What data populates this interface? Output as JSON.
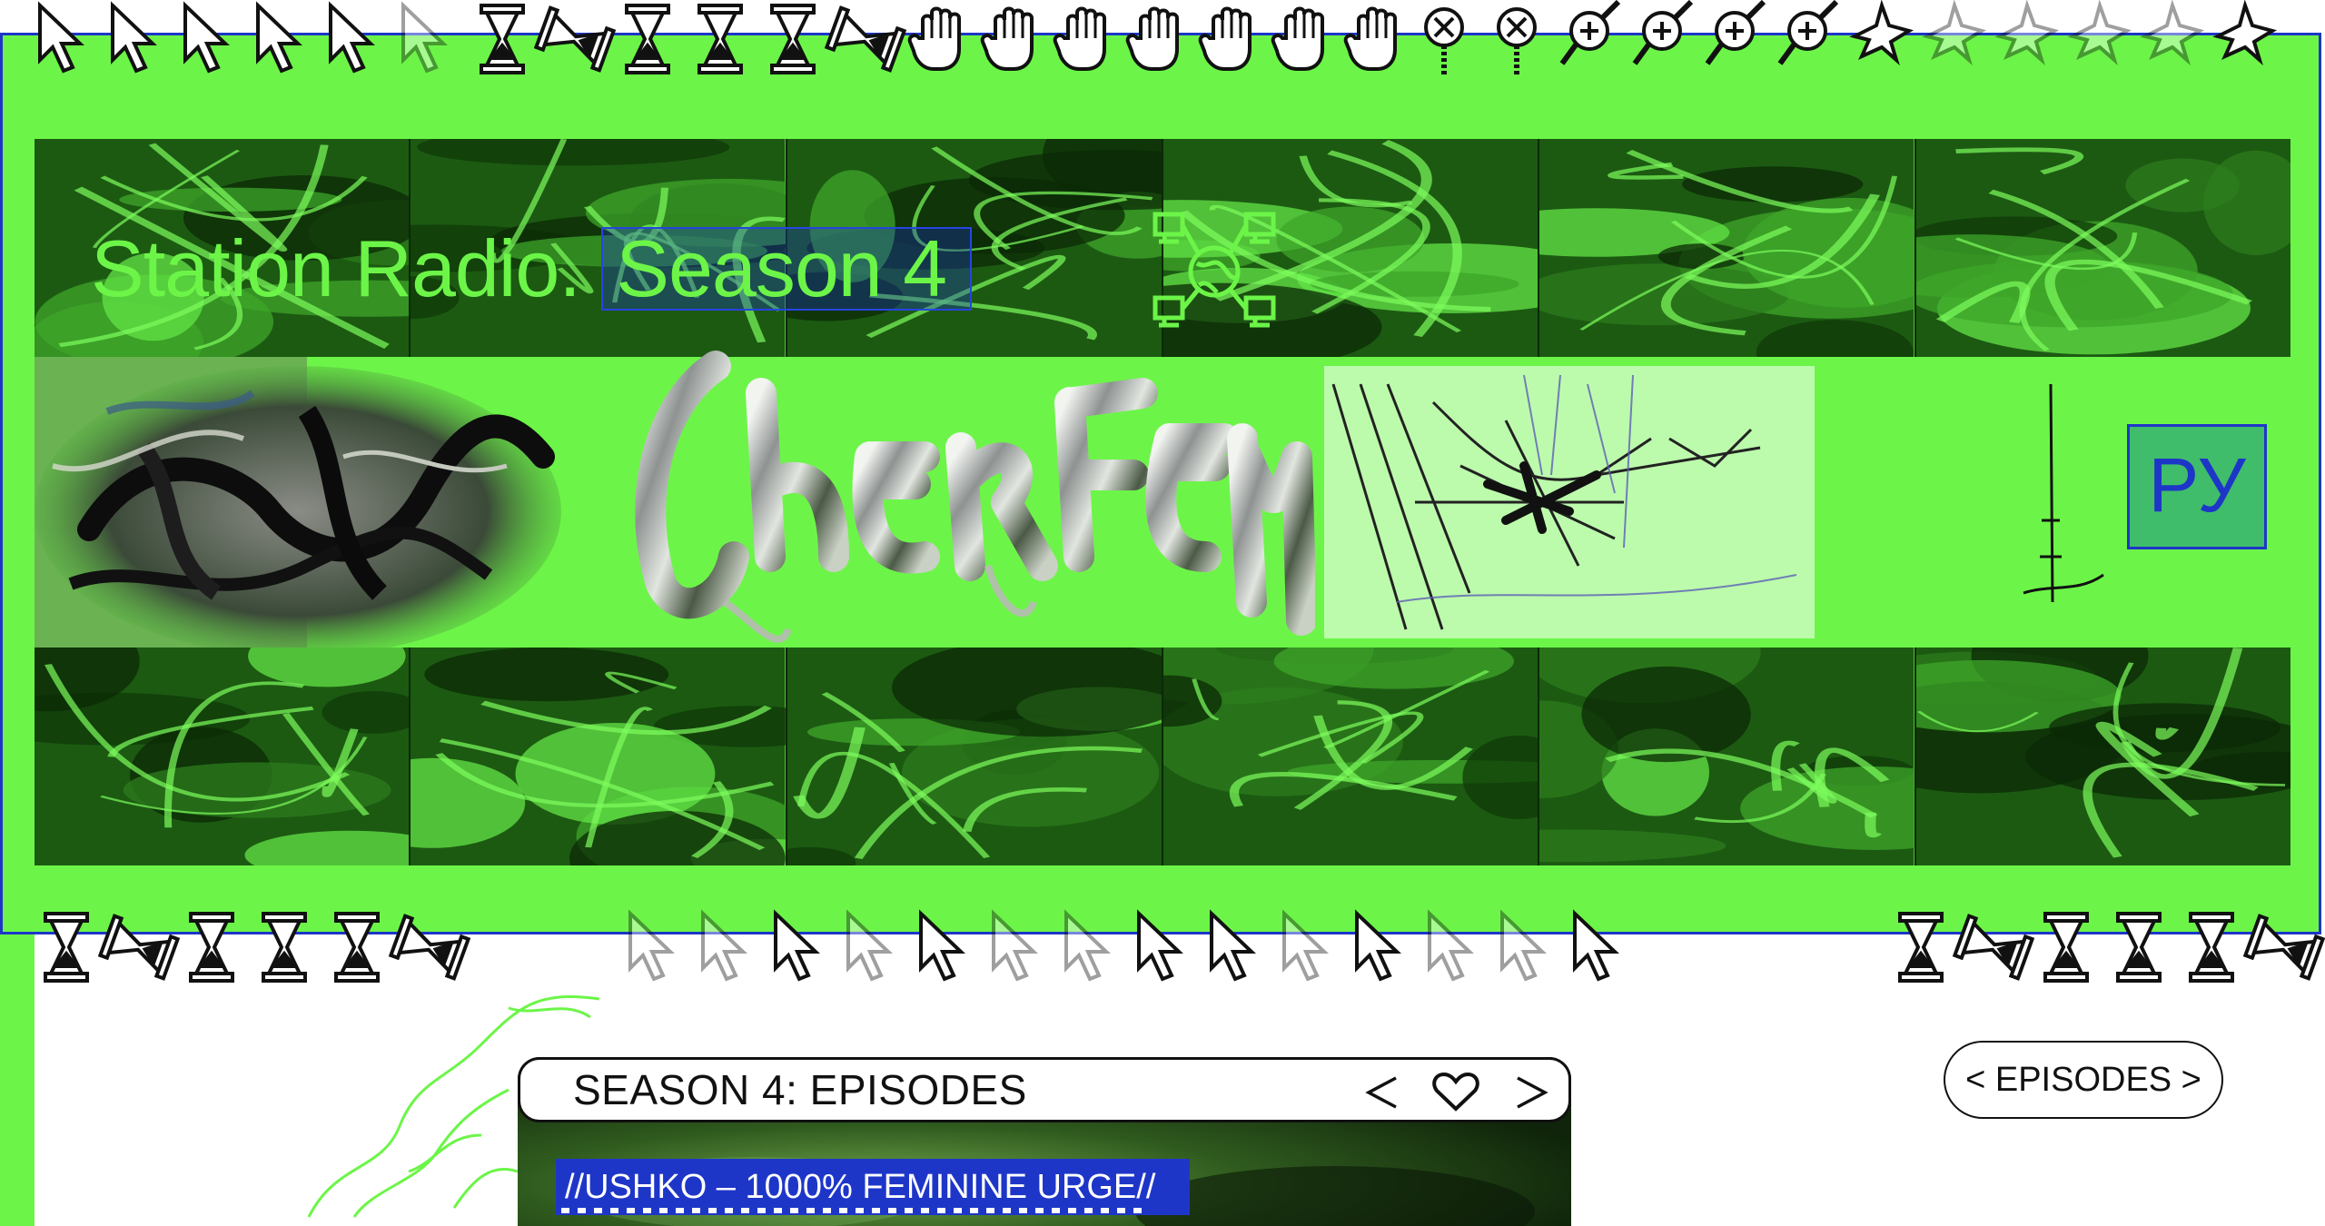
{
  "hero": {
    "title_plain": "Station Radio.",
    "title_highlight": "Season 4",
    "logo_text": "CHERTEM",
    "language_button": "РУ",
    "icon": "network-globe-icon"
  },
  "cursor_rows": {
    "top": [
      "arrow",
      "arrow",
      "arrow",
      "arrow",
      "arrow",
      "arrow-faded",
      "hourglass",
      "hourglass-tilt",
      "hourglass",
      "hourglass",
      "hourglass",
      "hourglass-tilt",
      "hand",
      "hand",
      "hand",
      "hand",
      "hand",
      "hand",
      "hand",
      "zoom-out",
      "zoom-out",
      "zoom-in",
      "zoom-in",
      "zoom-in",
      "zoom-in",
      "pointer-x",
      "pointer-x-faded",
      "pointer-x-faded",
      "pointer-x-faded",
      "pointer-x-faded",
      "pointer-x"
    ],
    "bottom_left": [
      "hourglass",
      "hourglass-tilt",
      "hourglass",
      "hourglass",
      "hourglass",
      "hourglass-tilt"
    ],
    "bottom_center": [
      "arrow-faded",
      "arrow-faded",
      "arrow",
      "arrow-faded",
      "arrow",
      "arrow-faded",
      "arrow-faded",
      "arrow",
      "arrow",
      "arrow-faded",
      "arrow",
      "arrow-faded",
      "arrow-faded",
      "arrow"
    ],
    "bottom_right": [
      "hourglass",
      "hourglass-tilt",
      "hourglass",
      "hourglass",
      "hourglass",
      "hourglass-tilt"
    ]
  },
  "episodes": {
    "panel_title": "SEASON 4: EPISODES",
    "prev_label": "<",
    "next_label": ">",
    "current_episode": "//USHKO – 1000% FEMININE URGE//",
    "nav_button": "< EPISODES >"
  },
  "colors": {
    "accent_green": "#6cf548",
    "accent_blue": "#1e36c8",
    "dark": "#111111"
  }
}
